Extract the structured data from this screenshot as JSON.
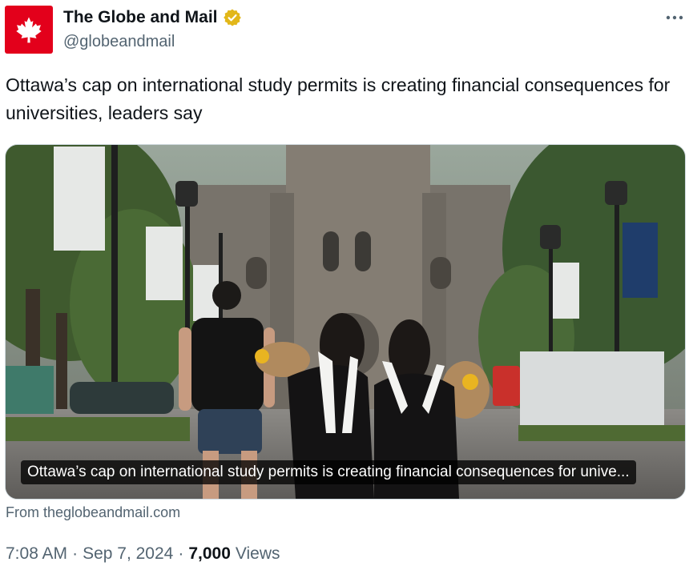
{
  "author": {
    "display_name": "The Globe and Mail",
    "handle": "@globeandmail",
    "avatar_color": "#e3001b",
    "verified_badge_color": "#e2b719"
  },
  "tweet": {
    "text": "Ottawa’s cap on international study permits is creating financial consequences for universities, leaders say"
  },
  "card": {
    "caption": "Ottawa’s cap on international study permits is creating financial consequences for unive...",
    "source": "From theglobeandmail.com"
  },
  "meta": {
    "time": "7:08 AM",
    "date": "Sep 7, 2024",
    "views_count": "7,000",
    "views_label": "Views",
    "separator": "·"
  },
  "icons": {
    "avatar": "maple-leaf-icon",
    "verified": "verified-badge-icon",
    "more": "more-icon"
  }
}
